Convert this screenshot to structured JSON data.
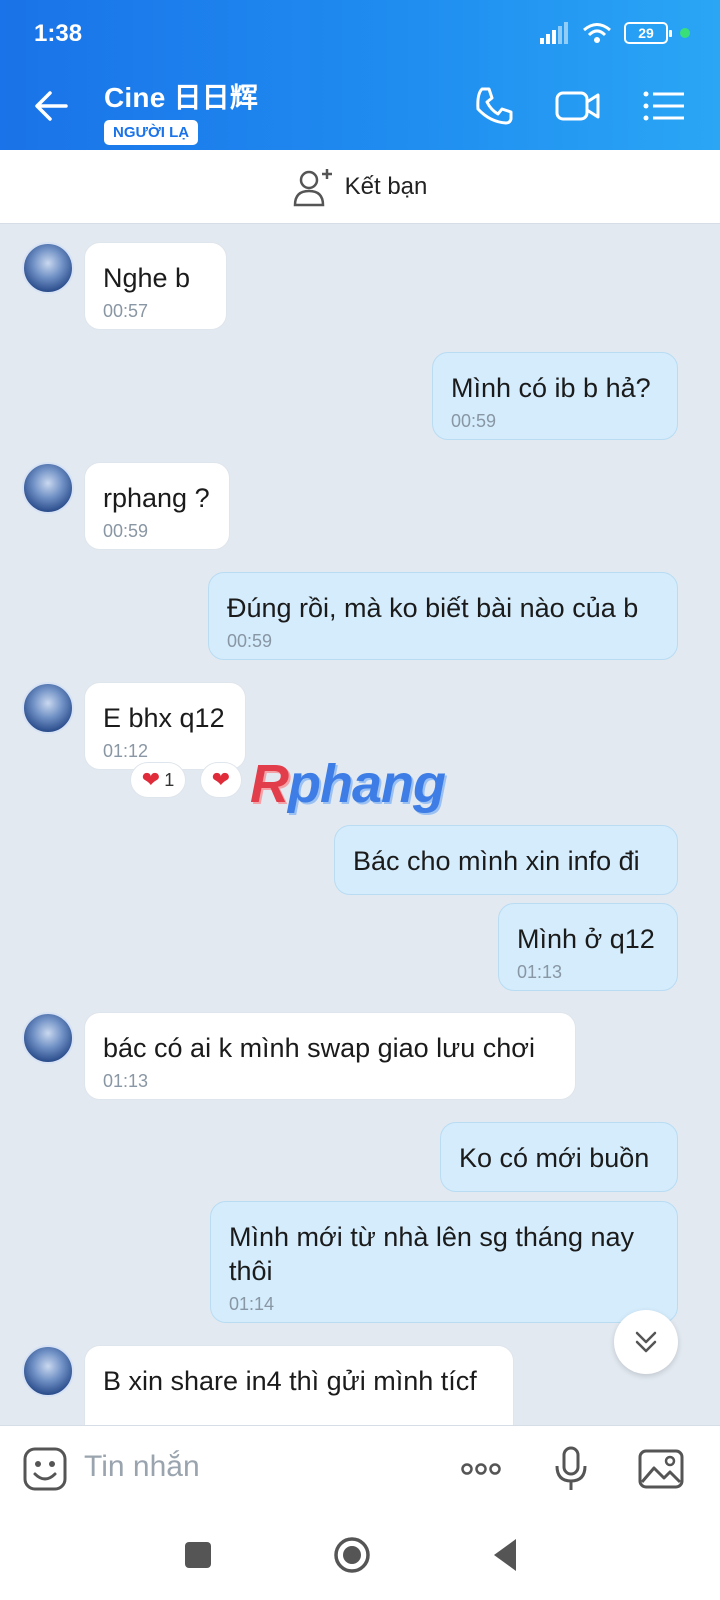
{
  "status": {
    "time": "1:38",
    "battery": "29"
  },
  "header": {
    "contact_name": "Cine 日日辉",
    "stranger_badge": "NGƯỜI LẠ"
  },
  "friend_bar": {
    "label": "Kết bạn"
  },
  "messages": [
    {
      "side": "in",
      "text": "Nghe b",
      "time": "00:57"
    },
    {
      "side": "out",
      "text": "Mình có ib b hả?",
      "time": "00:59"
    },
    {
      "side": "in",
      "text": "rphang ?",
      "time": "00:59"
    },
    {
      "side": "out",
      "text": "Đúng rồi, mà ko biết bài nào của b",
      "time": "00:59"
    },
    {
      "side": "in",
      "text": "E bhx q12",
      "time": "01:12"
    },
    {
      "side": "out",
      "text": "Bác cho mình xin info đi",
      "time": ""
    },
    {
      "side": "out",
      "text": "Mình ở q12",
      "time": "01:13"
    },
    {
      "side": "in",
      "text": "bác có ai k mình swap giao lưu chơi",
      "time": "01:13"
    },
    {
      "side": "out",
      "text": "Ko có mới buồn",
      "time": ""
    },
    {
      "side": "out",
      "text": "Mình mới từ nhà lên sg tháng nay\nthôi",
      "time": "01:14"
    },
    {
      "side": "in",
      "text": "B xin share in4 thì gửi mình tícf",
      "time": ""
    }
  ],
  "reaction": {
    "count": "1"
  },
  "watermark": {
    "prefix": "R",
    "rest": "phang"
  },
  "input": {
    "placeholder": "Tin nhắn"
  },
  "colors": {
    "accent": "#1a73e8",
    "outgoing_bubble": "#d4ecfc",
    "chat_bg": "#e2e9f1"
  }
}
